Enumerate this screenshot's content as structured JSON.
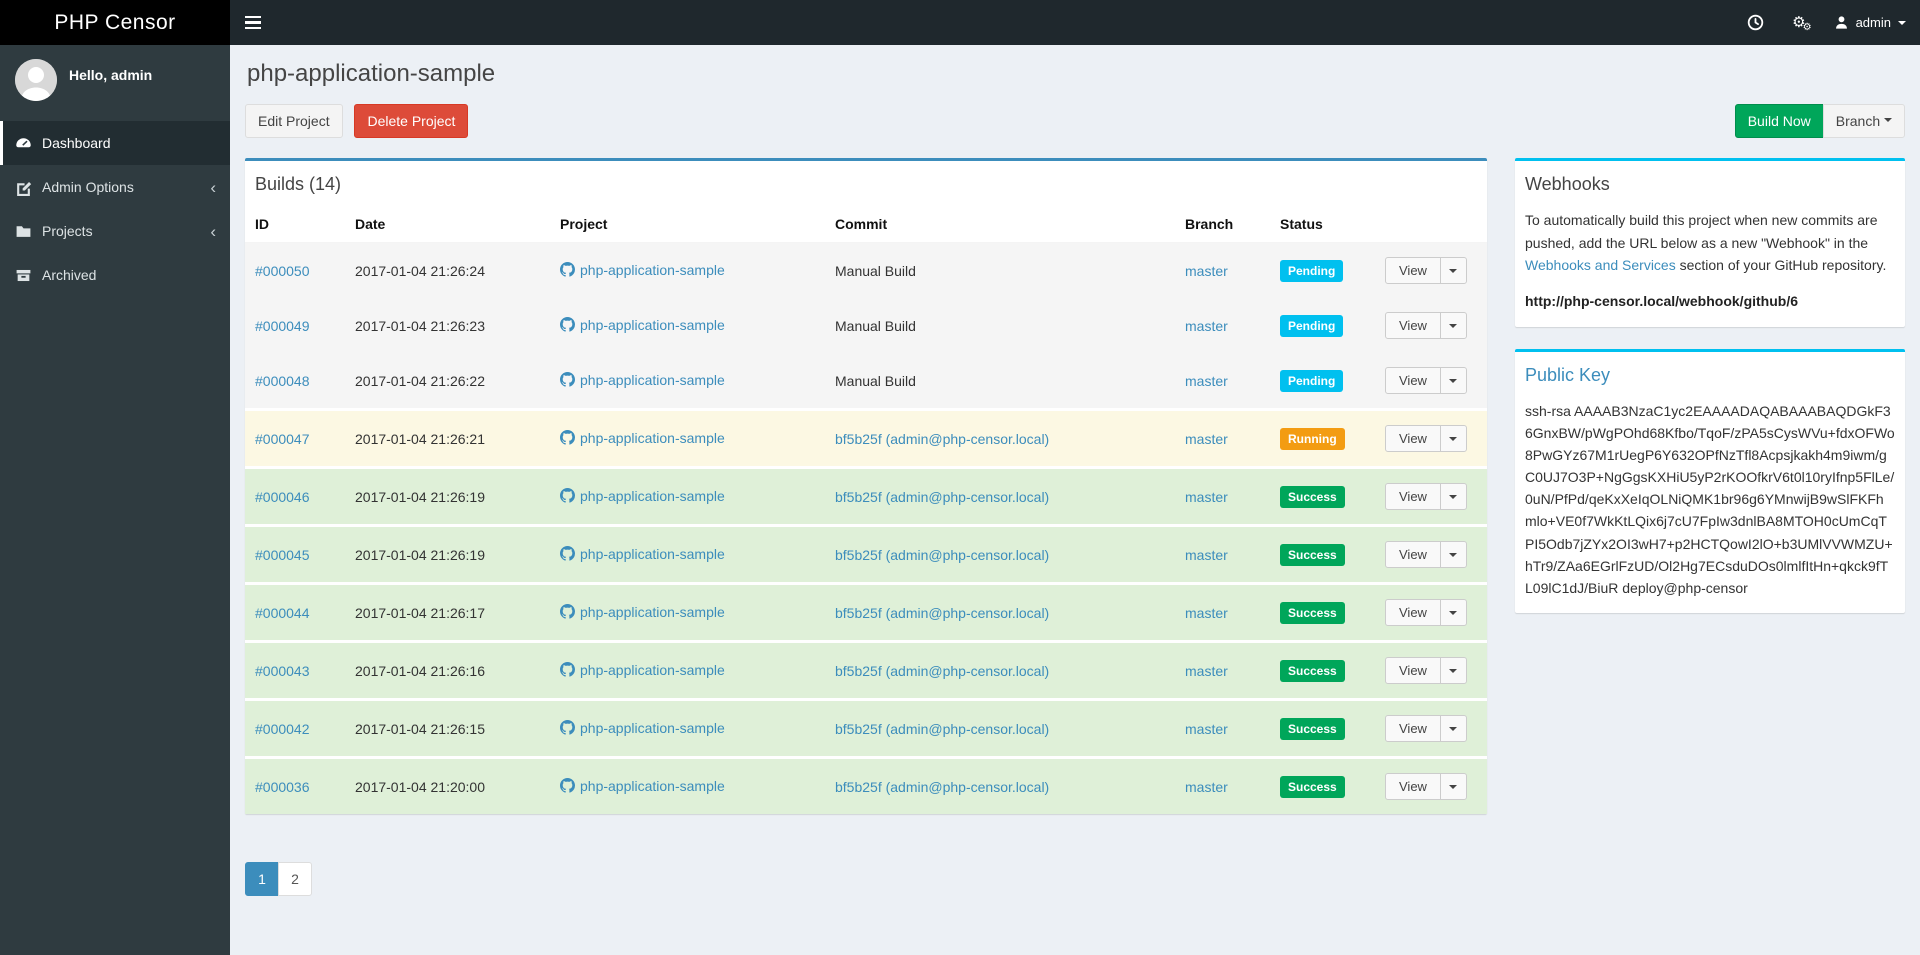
{
  "app": {
    "brand": "PHP Censor"
  },
  "navbar": {
    "user": "admin",
    "icons": [
      "menu-icon",
      "clock-icon",
      "gears-icon",
      "user-icon"
    ]
  },
  "sidebar": {
    "greeting": "Hello, admin",
    "items": [
      {
        "label": "Dashboard",
        "icon": "dashboard-icon",
        "state": "active",
        "chevron": ""
      },
      {
        "label": "Admin Options",
        "icon": "edit-icon",
        "state": "",
        "chevron": "‹"
      },
      {
        "label": "Projects",
        "icon": "folder-icon",
        "state": "",
        "chevron": "‹"
      },
      {
        "label": "Archived",
        "icon": "archive-icon",
        "state": "",
        "chevron": ""
      }
    ]
  },
  "page": {
    "title": "php-application-sample",
    "edit_label": "Edit Project",
    "delete_label": "Delete Project",
    "build_now_label": "Build Now",
    "branch_label": "Branch"
  },
  "builds": {
    "panel_title": "Builds (14)",
    "columns": [
      "ID",
      "Date",
      "Project",
      "Commit",
      "Branch",
      "Status",
      ""
    ],
    "view_label": "View",
    "rows": [
      {
        "id": "#000050",
        "date": "2017-01-04 21:26:24",
        "project": "php-application-sample",
        "commit": "Manual Build",
        "commit_class": "plain",
        "branch": "master",
        "status": "Pending",
        "row_class": "pending"
      },
      {
        "id": "#000049",
        "date": "2017-01-04 21:26:23",
        "project": "php-application-sample",
        "commit": "Manual Build",
        "commit_class": "plain",
        "branch": "master",
        "status": "Pending",
        "row_class": "pending"
      },
      {
        "id": "#000048",
        "date": "2017-01-04 21:26:22",
        "project": "php-application-sample",
        "commit": "Manual Build",
        "commit_class": "plain",
        "branch": "master",
        "status": "Pending",
        "row_class": "pending"
      },
      {
        "id": "#000047",
        "date": "2017-01-04 21:26:21",
        "project": "php-application-sample",
        "commit": "bf5b25f (admin@php-censor.local)",
        "commit_class": "link",
        "branch": "master",
        "status": "Running",
        "row_class": "running"
      },
      {
        "id": "#000046",
        "date": "2017-01-04 21:26:19",
        "project": "php-application-sample",
        "commit": "bf5b25f (admin@php-censor.local)",
        "commit_class": "link",
        "branch": "master",
        "status": "Success",
        "row_class": "success"
      },
      {
        "id": "#000045",
        "date": "2017-01-04 21:26:19",
        "project": "php-application-sample",
        "commit": "bf5b25f (admin@php-censor.local)",
        "commit_class": "link",
        "branch": "master",
        "status": "Success",
        "row_class": "success"
      },
      {
        "id": "#000044",
        "date": "2017-01-04 21:26:17",
        "project": "php-application-sample",
        "commit": "bf5b25f (admin@php-censor.local)",
        "commit_class": "link",
        "branch": "master",
        "status": "Success",
        "row_class": "success"
      },
      {
        "id": "#000043",
        "date": "2017-01-04 21:26:16",
        "project": "php-application-sample",
        "commit": "bf5b25f (admin@php-censor.local)",
        "commit_class": "link",
        "branch": "master",
        "status": "Success",
        "row_class": "success"
      },
      {
        "id": "#000042",
        "date": "2017-01-04 21:26:15",
        "project": "php-application-sample",
        "commit": "bf5b25f (admin@php-censor.local)",
        "commit_class": "link",
        "branch": "master",
        "status": "Success",
        "row_class": "success"
      },
      {
        "id": "#000036",
        "date": "2017-01-04 21:20:00",
        "project": "php-application-sample",
        "commit": "bf5b25f (admin@php-censor.local)",
        "commit_class": "link",
        "branch": "master",
        "status": "Success",
        "row_class": "success"
      }
    ]
  },
  "pagination": {
    "pages": [
      {
        "label": "1",
        "state": "active"
      },
      {
        "label": "2",
        "state": ""
      }
    ]
  },
  "webhooks": {
    "title": "Webhooks",
    "text_before": "To automatically build this project when new commits are pushed, add the URL below as a new \"Webhook\" in the ",
    "link_text": "Webhooks and Services",
    "text_after": " section of your GitHub repository.",
    "url": "http://php-censor.local/webhook/github/6"
  },
  "public_key": {
    "title": "Public Key",
    "value": "ssh-rsa AAAAB3NzaC1yc2EAAAADAQABAAABAQDGkF36GnxBW/pWgPOhd68Kfbo/TqoF/zPA5sCysWVu+fdxOFWo8PwGYz67M1rUegP6Y632OPfNzTfl8Acpsjkakh4m9iwm/gC0UJ7O3P+NgGgsKXHiU5yP2rKOOfkrV6t0l10ryIfnp5FlLe/0uN/PfPd/qeKxXeIqOLNiQMK1br96g6YMnwijB9wSlFKFhmlo+VE0f7WkKtLQix6j7cU7FpIw3dnlBA8MTOH0cUmCqTPI5Odb7jZYx2OI3wH7+p2HCTQowI2lO+b3UMlVVWMZU+hTr9/ZAa6EGrlFzUD/Ol2Hg7ECsduDOs0lmlfItHn+qkck9fTL09lC1dJ/BiuR deploy@php-censor"
  },
  "colors": {
    "primary": "#3c8dbc",
    "info": "#00c0ef",
    "success": "#00a65a",
    "warning": "#f39c12",
    "danger": "#dd4b39",
    "navbar_bg": "#1f282d",
    "logo_bg": "#000000",
    "sidebar_bg": "#2f3b40",
    "content_bg": "#ecf0f5",
    "row_pending_bg": "#f5f5f5",
    "row_running_bg": "#fcf8e3",
    "row_success_bg": "#dff0d8"
  }
}
